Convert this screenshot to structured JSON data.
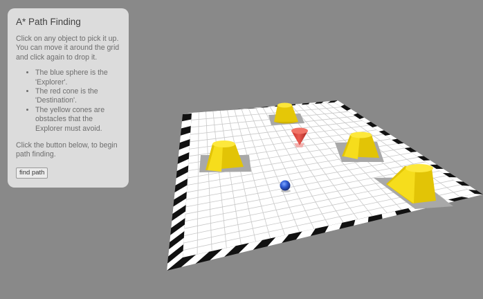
{
  "panel": {
    "title": "A* Path Finding",
    "intro": "Click on any object to pick it up. You can move it around the grid and click again to drop it.",
    "bullets": [
      "The blue sphere is the 'Explorer'.",
      "The red cone is the 'Destination'.",
      "The yellow cones are obstacles that the Explorer must avoid."
    ],
    "outro": "Click the button below, to begin path finding.",
    "button_label": "find path"
  },
  "scene": {
    "grid_size": 20,
    "objects": [
      {
        "name": "explorer",
        "shape": "sphere",
        "color": "#2f5bd3"
      },
      {
        "name": "destination",
        "shape": "cone",
        "color": "#e0473f"
      },
      {
        "name": "obstacle",
        "shape": "truncated-cone",
        "color": "#f2dd10"
      },
      {
        "name": "obstacle",
        "shape": "truncated-cone",
        "color": "#f2dd10"
      },
      {
        "name": "obstacle",
        "shape": "truncated-cone",
        "color": "#f2dd10"
      },
      {
        "name": "obstacle",
        "shape": "truncated-cone",
        "color": "#f2dd10"
      }
    ],
    "colors": {
      "background": "#898989",
      "board": "#ffffff",
      "border_dark": "#111111",
      "border_light": "#ffffff",
      "gridline": "#c8c8c8",
      "obstacle": "#f2dd10",
      "explorer": "#2f5bd3",
      "destination": "#e0473f"
    }
  }
}
